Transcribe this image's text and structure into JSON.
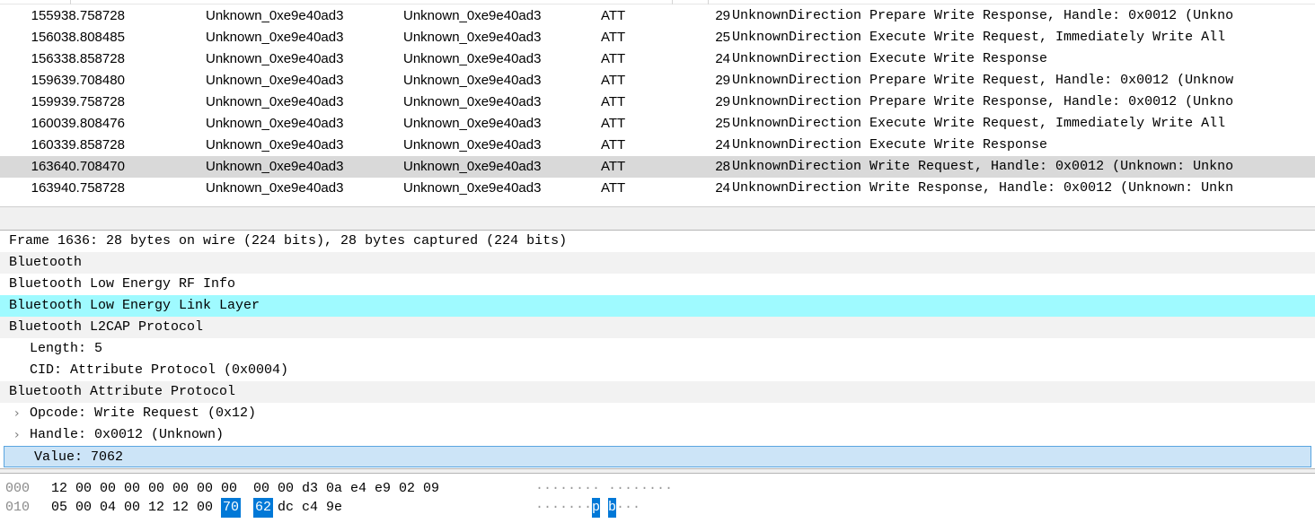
{
  "packet_list": {
    "rows": [
      {
        "no": "1559",
        "time": "38.758728",
        "source": "Unknown_0xe9e40ad3",
        "destination": "Unknown_0xe9e40ad3",
        "protocol": "ATT",
        "length": "29",
        "info": "UnknownDirection Prepare Write Response, Handle: 0x0012 (Unkno"
      },
      {
        "no": "1560",
        "time": "38.808485",
        "source": "Unknown_0xe9e40ad3",
        "destination": "Unknown_0xe9e40ad3",
        "protocol": "ATT",
        "length": "25",
        "info": "UnknownDirection Execute Write Request, Immediately Write All"
      },
      {
        "no": "1563",
        "time": "38.858728",
        "source": "Unknown_0xe9e40ad3",
        "destination": "Unknown_0xe9e40ad3",
        "protocol": "ATT",
        "length": "24",
        "info": "UnknownDirection Execute Write Response"
      },
      {
        "no": "1596",
        "time": "39.708480",
        "source": "Unknown_0xe9e40ad3",
        "destination": "Unknown_0xe9e40ad3",
        "protocol": "ATT",
        "length": "29",
        "info": "UnknownDirection Prepare Write Request, Handle: 0x0012 (Unknow"
      },
      {
        "no": "1599",
        "time": "39.758728",
        "source": "Unknown_0xe9e40ad3",
        "destination": "Unknown_0xe9e40ad3",
        "protocol": "ATT",
        "length": "29",
        "info": "UnknownDirection Prepare Write Response, Handle: 0x0012 (Unkno"
      },
      {
        "no": "1600",
        "time": "39.808476",
        "source": "Unknown_0xe9e40ad3",
        "destination": "Unknown_0xe9e40ad3",
        "protocol": "ATT",
        "length": "25",
        "info": "UnknownDirection Execute Write Request, Immediately Write All"
      },
      {
        "no": "1603",
        "time": "39.858728",
        "source": "Unknown_0xe9e40ad3",
        "destination": "Unknown_0xe9e40ad3",
        "protocol": "ATT",
        "length": "24",
        "info": "UnknownDirection Execute Write Response"
      },
      {
        "no": "1636",
        "time": "40.708470",
        "source": "Unknown_0xe9e40ad3",
        "destination": "Unknown_0xe9e40ad3",
        "protocol": "ATT",
        "length": "28",
        "info": "UnknownDirection Write Request, Handle: 0x0012 (Unknown: Unkno",
        "selected": true
      },
      {
        "no": "1639",
        "time": "40.758728",
        "source": "Unknown_0xe9e40ad3",
        "destination": "Unknown_0xe9e40ad3",
        "protocol": "ATT",
        "length": "24",
        "info": "UnknownDirection Write Response, Handle: 0x0012 (Unknown: Unkn"
      }
    ]
  },
  "packet_details": {
    "frame": "Frame 1636: 28 bytes on wire (224 bits), 28 bytes captured (224 bits)",
    "bluetooth": "Bluetooth",
    "ble_rf_info": "Bluetooth Low Energy RF Info",
    "ble_link_layer": "Bluetooth Low Energy Link Layer",
    "l2cap": "Bluetooth L2CAP Protocol",
    "l2cap_length": "Length: 5",
    "l2cap_cid": "CID: Attribute Protocol (0x0004)",
    "att": "Bluetooth Attribute Protocol",
    "opcode": "Opcode: Write Request (0x12)",
    "handle": "Handle: 0x0012 (Unknown)",
    "value": "Value: 7062",
    "expander_glyph": "›"
  },
  "packet_bytes": {
    "rows": [
      {
        "offset": "000",
        "bytes": [
          "12",
          "00",
          "00",
          "00",
          "00",
          "00",
          "00",
          "00",
          "00",
          "00",
          "d3",
          "0a",
          "e4",
          "e9",
          "02",
          "09"
        ],
        "ascii": [
          "·",
          "·",
          "·",
          "·",
          "·",
          "·",
          "·",
          "·",
          "·",
          "·",
          "·",
          "·",
          "·",
          "·",
          "·",
          "·"
        ]
      },
      {
        "offset": "010",
        "bytes": [
          "05",
          "00",
          "04",
          "00",
          "12",
          "12",
          "00",
          "70",
          "62",
          "dc",
          "c4",
          "9e"
        ],
        "ascii": [
          "·",
          "·",
          "·",
          "·",
          "·",
          "·",
          "·",
          "p",
          "b",
          "·",
          "·",
          "·"
        ],
        "selected": [
          7,
          8
        ]
      }
    ]
  },
  "colors": {
    "selected_row": "#d9d9d9",
    "link_layer_highlight": "#9ffaff",
    "value_highlight": "#cce4f7",
    "byte_selection": "#0078d7"
  }
}
